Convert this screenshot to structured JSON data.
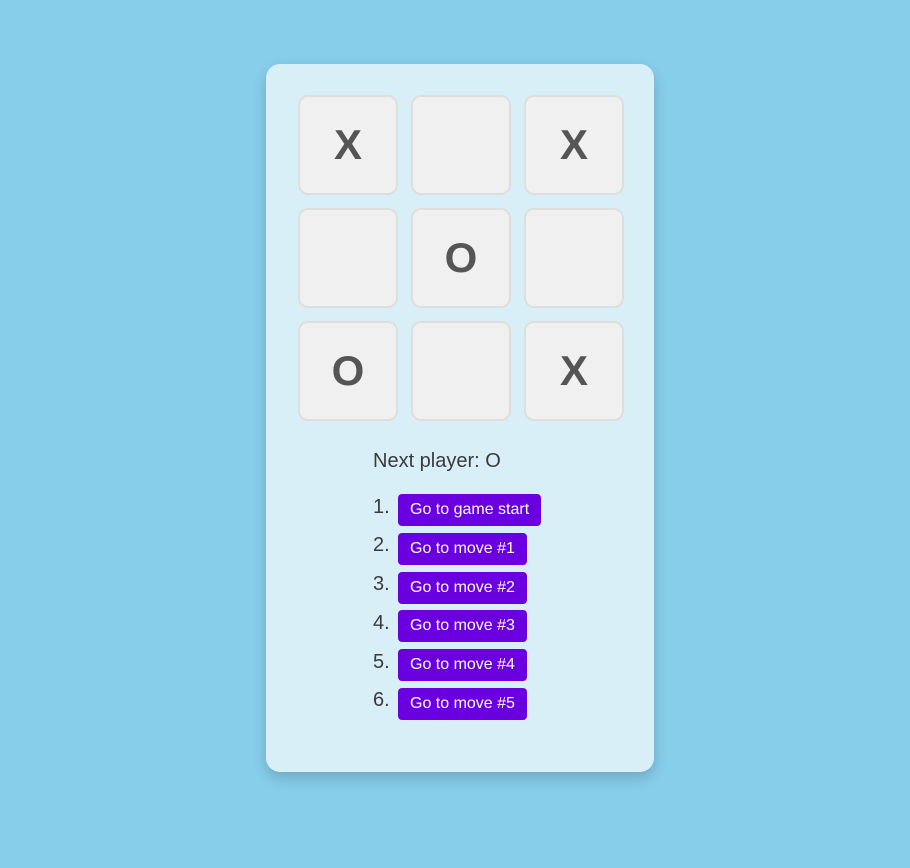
{
  "board": {
    "squares": [
      "X",
      "",
      "X",
      "",
      "O",
      "",
      "O",
      "",
      "X"
    ]
  },
  "status": {
    "text": "Next player: O"
  },
  "moves": [
    {
      "number": "1.",
      "label": "Go to game start"
    },
    {
      "number": "2.",
      "label": "Go to move #1"
    },
    {
      "number": "3.",
      "label": "Go to move #2"
    },
    {
      "number": "4.",
      "label": "Go to move #3"
    },
    {
      "number": "5.",
      "label": "Go to move #4"
    },
    {
      "number": "6.",
      "label": "Go to move #5"
    }
  ],
  "colors": {
    "background": "#87ceeb",
    "card": "#d9eff8",
    "square": "#f0f0f0",
    "mark": "#555555",
    "button": "#6a00e0"
  }
}
